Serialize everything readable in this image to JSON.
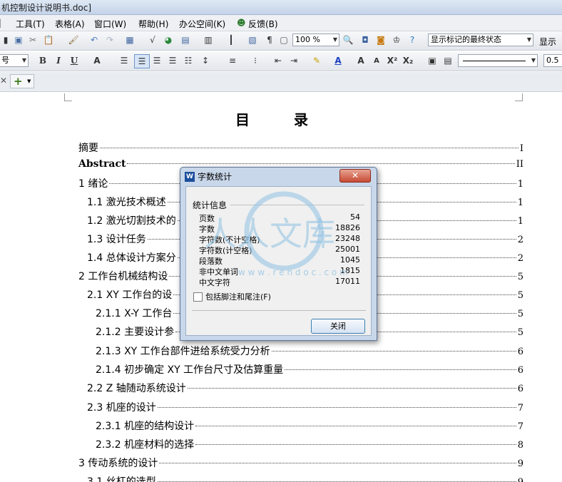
{
  "window": {
    "title": "机控制设计说明书.doc]"
  },
  "menu": [
    "工具(T)",
    "表格(A)",
    "窗口(W)",
    "帮助(H)",
    "办公空间(K)",
    "反馈(B)"
  ],
  "toolbar": {
    "zoom": "100 %",
    "markup_state": "显示标记的最终状态",
    "show_label": "显示",
    "font_size": "号",
    "line_weight": "0.5",
    "bold": "B",
    "italic": "I",
    "underline": "U",
    "superscript": "X²",
    "subscript": "X₂"
  },
  "document": {
    "toc_title": "目录",
    "toc": [
      {
        "text": "摘要",
        "page": "I"
      },
      {
        "text": "Abstract",
        "page": "II"
      },
      {
        "text": "1  绪论",
        "page": "1"
      },
      {
        "text": "1.1 激光技术概述",
        "page": "1"
      },
      {
        "text": "1.2 激光切割技术的",
        "page": "1"
      },
      {
        "text": "1.3 设计任务",
        "page": "2"
      },
      {
        "text": "1.4 总体设计方案分",
        "page": "2"
      },
      {
        "text": "2  工作台机械结构设",
        "page": "5"
      },
      {
        "text": "2.1  XY 工作台的设",
        "page": "5"
      },
      {
        "text": "2.1.1  X-Y 工作台",
        "page": "5"
      },
      {
        "text": "2.1.2 主要设计参",
        "page": "5"
      },
      {
        "text": "2.1.3  XY 工作台部件进给系统受力分析",
        "page": "6"
      },
      {
        "text": "2.1.4 初步确定 XY 工作台尺寸及估算重量",
        "page": "6"
      },
      {
        "text": "2.2  Z 轴随动系统设计",
        "page": "6"
      },
      {
        "text": "2.3  机座的设计",
        "page": "7"
      },
      {
        "text": "2.3.1  机座的结构设计",
        "page": "7"
      },
      {
        "text": "2.3.2 机座材料的选择",
        "page": "8"
      },
      {
        "text": "3  传动系统的设计",
        "page": "9"
      },
      {
        "text": "3.1 丝杠的选型",
        "page": "9"
      }
    ]
  },
  "dialog": {
    "title": "字数统计",
    "close_x": "✕",
    "group": "统计信息",
    "stats": [
      {
        "label": "页数",
        "value": "54"
      },
      {
        "label": "字数",
        "value": "18826"
      },
      {
        "label": "字符数(不计空格)",
        "value": "23248"
      },
      {
        "label": "字符数(计空格)",
        "value": "25001"
      },
      {
        "label": "段落数",
        "value": "1045"
      },
      {
        "label": "非中文单词",
        "value": "1815"
      },
      {
        "label": "中文字符",
        "value": "17011"
      }
    ],
    "checkbox": "包括脚注和尾注(F)",
    "close_button": "关闭"
  },
  "watermark": {
    "text": "人人文库",
    "url": "w w w . r e n d o c . c o m"
  },
  "colors": {
    "accent": "#3c7fb1",
    "close_red": "#c74a34",
    "watermark": "#8fc1e3"
  }
}
